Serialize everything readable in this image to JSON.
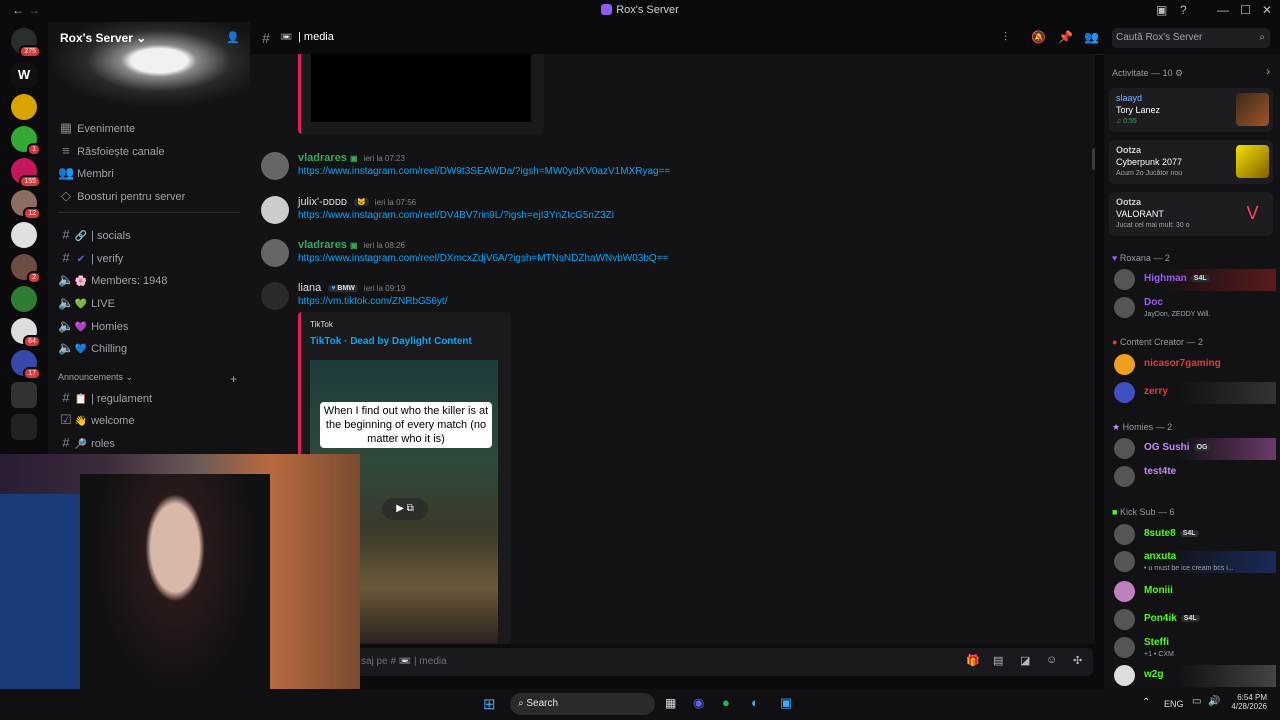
{
  "window": {
    "title": "Rox's Server",
    "search_placeholder": "Caută Rox's Server"
  },
  "server_rail": {
    "badges": [
      "275",
      "1",
      "155",
      "12",
      "2",
      "64",
      "17"
    ]
  },
  "sidebar": {
    "server_name": "Rox's Server",
    "quick_links": [
      {
        "icon": "calendar-icon",
        "label": "Evenimente"
      },
      {
        "icon": "browse-channels-icon",
        "label": "Răsfoiește canale"
      },
      {
        "icon": "members-icon",
        "label": "Membri"
      },
      {
        "icon": "boost-icon",
        "label": "Boosturi pentru server"
      }
    ],
    "channels": [
      {
        "emoji": "🔗",
        "label": "| socials"
      },
      {
        "emoji": "✔",
        "label": "| verify"
      },
      {
        "emoji": "🌸",
        "label": "Members: 1948"
      },
      {
        "emoji": "💚",
        "label": "LIVE"
      },
      {
        "emoji": "💜",
        "label": "Homies"
      },
      {
        "emoji": "💙",
        "label": "Chilling"
      }
    ],
    "category": "Announcements",
    "announcement_channels": [
      {
        "emoji": "📋",
        "label": "| regulament"
      },
      {
        "emoji": "👋",
        "label": "welcome"
      },
      {
        "emoji": "🔎",
        "label": "roles"
      }
    ]
  },
  "header": {
    "channel_name": "| media"
  },
  "chat": {
    "messages": [
      {
        "user": "vladrares",
        "time": "ieri la 07:23",
        "color": "#3ba55d",
        "link": "https://www.instagram.com/reel/DW9t3SEAWDa/?igsh=MW0ydXV0azV1MXRyag=="
      },
      {
        "user": "julix'-ᴅᴅᴅᴅ",
        "time": "ieri la 07:56",
        "color": "#dbdee1",
        "link": "https://www.instagram.com/reel/DV4BV7rin9L/?igsh=ejI3YnZtcG5nZ3Zi"
      },
      {
        "user": "vladrares",
        "time": "ieri la 08:26",
        "color": "#3ba55d",
        "link": "https://www.instagram.com/reel/DXmcxZdjV6A/?igsh=MTNsNDZhaWNvbW03bQ=="
      },
      {
        "user": "liana",
        "time": "ieri la 09:19",
        "color": "#dbdee1",
        "role_tag": "BMW",
        "link": "https://vm.tiktok.com/ZNRbG56yt/"
      }
    ],
    "embed": {
      "provider": "TikTok",
      "title": "TikTok · Dead by Daylight Content",
      "caption": "When I find out who the killer is at the beginning of every match (no matter who it is)"
    },
    "composer_placeholder": "saj pe #",
    "composer_channel": "| media"
  },
  "members": {
    "activity_header": "Activitate — 10",
    "activities": [
      {
        "user": "slaayd",
        "title": "Tory Lanez",
        "status": "0:55"
      },
      {
        "user": "Ootza",
        "title": "Cyberpunk 2077",
        "status": "Acum 2o  Jucător nou"
      },
      {
        "user": "Ootza",
        "title": "VALORANT",
        "status": "Jucat cel mai mult: 30 o"
      }
    ],
    "groups": [
      {
        "name": "Roxana — 2",
        "members": [
          {
            "name": "Highman",
            "color": "#9b5cf6",
            "tag": "S4L",
            "status": ""
          },
          {
            "name": "Doc",
            "color": "#9b5cf6",
            "tag": "",
            "status": "JayDon, ZEDDY Will."
          }
        ]
      },
      {
        "name": "Content Creator — 2",
        "members": [
          {
            "name": "nicasor7gaming",
            "color": "#e03e3e",
            "tag": "",
            "status": ""
          },
          {
            "name": "zerry",
            "color": "#e03e3e",
            "tag": "",
            "status": ""
          }
        ]
      },
      {
        "name": "Homies — 2",
        "members": [
          {
            "name": "OG Sushi",
            "color": "#c58af9",
            "tag": "OG",
            "status": ""
          },
          {
            "name": "test4te",
            "color": "#c58af9",
            "tag": "",
            "status": ""
          }
        ]
      },
      {
        "name": "Kick Sub — 6",
        "members": [
          {
            "name": "8sute8",
            "color": "#53fc18",
            "tag": "S4L",
            "status": ""
          },
          {
            "name": "anxuta",
            "color": "#53fc18",
            "tag": "",
            "status": "• u must be ice cream bcs i..."
          },
          {
            "name": "Moniii",
            "color": "#53fc18",
            "tag": "",
            "status": ""
          },
          {
            "name": "Pon4ik",
            "color": "#53fc18",
            "tag": "S4L",
            "status": ""
          },
          {
            "name": "Steffi",
            "color": "#53fc18",
            "tag": "",
            "status": "+1 • CXM"
          },
          {
            "name": "w2g",
            "color": "#53fc18",
            "tag": "",
            "status": ""
          }
        ]
      }
    ]
  },
  "taskbar": {
    "search_label": "Search",
    "language": "ENG",
    "time": "6:54 PM",
    "date": "4/28/2026"
  }
}
